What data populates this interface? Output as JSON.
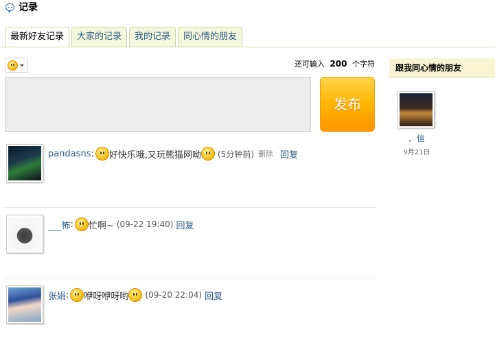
{
  "header": {
    "title": "记录"
  },
  "tabs": [
    {
      "label": "最新好友记录",
      "active": true
    },
    {
      "label": "大家的记录",
      "active": false
    },
    {
      "label": "我的记录",
      "active": false
    },
    {
      "label": "同心情的朋友",
      "active": false
    }
  ],
  "composer": {
    "counter_prefix": "还可输入",
    "counter_value": "200",
    "counter_suffix": "个字符",
    "publish_label": "发布"
  },
  "feed": [
    {
      "user": "pandasns",
      "message_a": "好快乐哦,又玩熊猫网呦",
      "message_b": "",
      "time": "(5分钟前)",
      "delete_label": "删除",
      "reply_label": "回复"
    },
    {
      "user": "___怖",
      "message_a": "忙啊~",
      "message_b": "",
      "time": "(09-22 19:40)",
      "reply_label": "回复"
    },
    {
      "user": "张娟",
      "message_a": "咿呀咿呀哟",
      "message_b": "",
      "time": "(09-20 22:04)",
      "reply_label": "回复"
    }
  ],
  "sidebar": {
    "title": "跟我同心情的朋友",
    "friend": {
      "name": "、信",
      "date": "9月21日"
    }
  },
  "colors": {
    "accent": "#2b5b85",
    "tab_bg": "#f3f7dc",
    "publish": "#ffb400",
    "sidebar_bg": "#f7f3d3"
  }
}
